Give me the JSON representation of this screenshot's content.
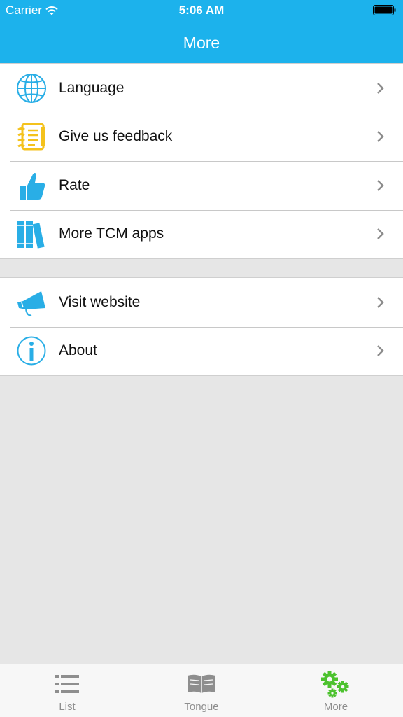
{
  "status_bar": {
    "carrier": "Carrier",
    "time": "5:06 AM"
  },
  "nav": {
    "title": "More"
  },
  "sections": [
    {
      "items": [
        {
          "label": "Language",
          "icon": "globe-icon"
        },
        {
          "label": "Give us feedback",
          "icon": "notebook-icon"
        },
        {
          "label": "Rate",
          "icon": "thumbs-up-icon"
        },
        {
          "label": "More TCM apps",
          "icon": "books-icon"
        }
      ]
    },
    {
      "items": [
        {
          "label": "Visit website",
          "icon": "megaphone-icon"
        },
        {
          "label": "About",
          "icon": "info-icon"
        }
      ]
    }
  ],
  "tabbar": {
    "tabs": [
      {
        "label": "List",
        "icon": "list-icon",
        "selected": false
      },
      {
        "label": "Tongue",
        "icon": "book-icon",
        "selected": false
      },
      {
        "label": "More",
        "icon": "gears-icon",
        "selected": true
      }
    ]
  },
  "colors": {
    "header": "#1cb2ec",
    "icon_blue": "#29aee6",
    "icon_yellow": "#f4c21c",
    "tab_active": "#4cc22e",
    "tab_inactive": "#8e8e8e"
  }
}
